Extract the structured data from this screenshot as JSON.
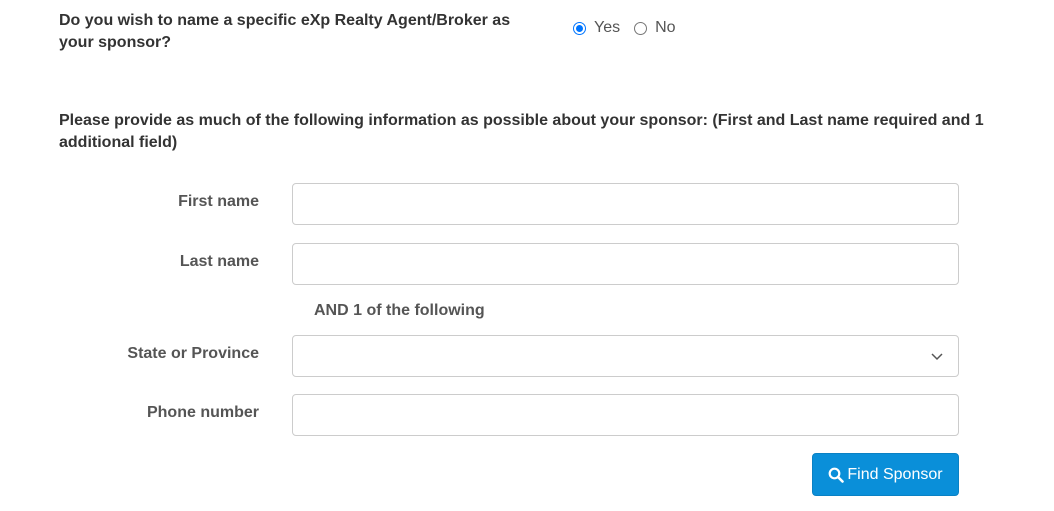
{
  "sponsor_question": {
    "text": "Do you wish to name a specific eXp Realty Agent/Broker as your sponsor?",
    "options": [
      {
        "label": "Yes",
        "checked": true
      },
      {
        "label": "No",
        "checked": false
      }
    ]
  },
  "instructions": "Please provide as much of the following information as possible about your sponsor: (First and Last name required and 1 additional field)",
  "form": {
    "first_name_label": "First name",
    "first_name_value": "",
    "last_name_label": "Last name",
    "last_name_value": "",
    "and_text": "AND 1 of the following",
    "state_label": "State or Province",
    "state_value": "",
    "phone_label": "Phone number",
    "phone_value": ""
  },
  "find_button": {
    "label": "Find Sponsor",
    "icon": "search-icon",
    "color": "#0a8fd9"
  }
}
